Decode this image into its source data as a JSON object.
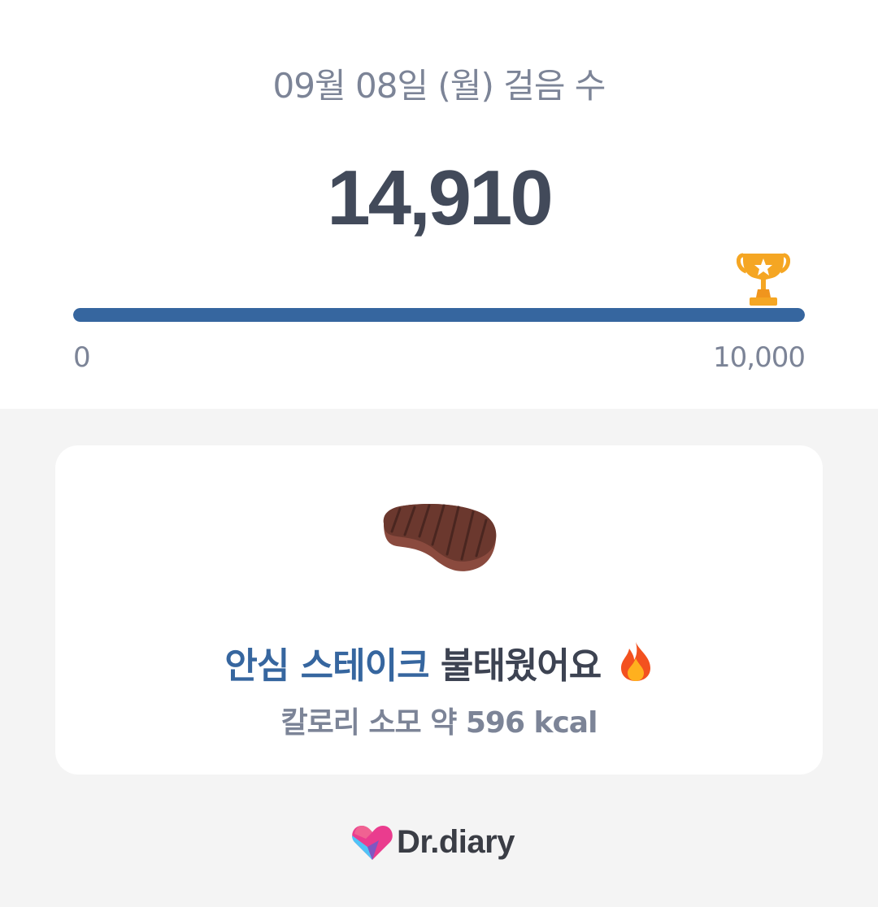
{
  "header": {
    "date_title": "09월 08일 (월) 걸음 수",
    "step_count": "14,910"
  },
  "progress": {
    "min_label": "0",
    "max_label": "10,000",
    "fraction": 1.0,
    "icon": "trophy-icon"
  },
  "burn_card": {
    "food_name": "안심 스테이크",
    "burn_text": "불태웠어요",
    "calorie_text": "칼로리 소모 약 596 kcal",
    "food_icon": "steak-icon",
    "fire_icon": "fire-icon"
  },
  "brand": {
    "name": "Dr.diary",
    "icon": "dr-diary-logo-icon"
  },
  "colors": {
    "accent": "#36669f",
    "text_dark": "#424a5a",
    "text_muted": "#7c8497",
    "background": "#f4f4f4",
    "trophy": "#f5a623"
  }
}
